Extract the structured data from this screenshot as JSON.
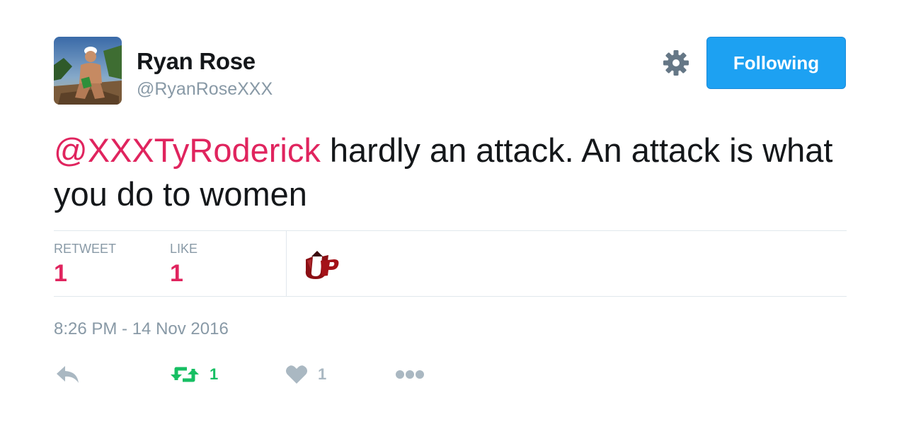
{
  "author": {
    "name": "Ryan Rose",
    "handle": "@RyanRoseXXX"
  },
  "follow_button": {
    "label": "Following"
  },
  "tweet": {
    "mention": "@XXXTyRoderick",
    "text": " hardly an attack. An attack is what you do to women"
  },
  "stats": {
    "retweet_label": "RETWEET",
    "retweet_count": "1",
    "like_label": "LIKE",
    "like_count": "1"
  },
  "timestamp": "8:26 PM - 14 Nov 2016",
  "actions": {
    "reply_icon": "reply-icon",
    "retweet_icon": "retweet-icon",
    "retweet_count": "1",
    "like_icon": "heart-icon",
    "like_count": "1",
    "more_icon": "more-dots-icon"
  },
  "colors": {
    "mention": "#e0245e",
    "button": "#1da1f2",
    "retweet_green": "#17bf63",
    "muted": "#8899a6"
  }
}
